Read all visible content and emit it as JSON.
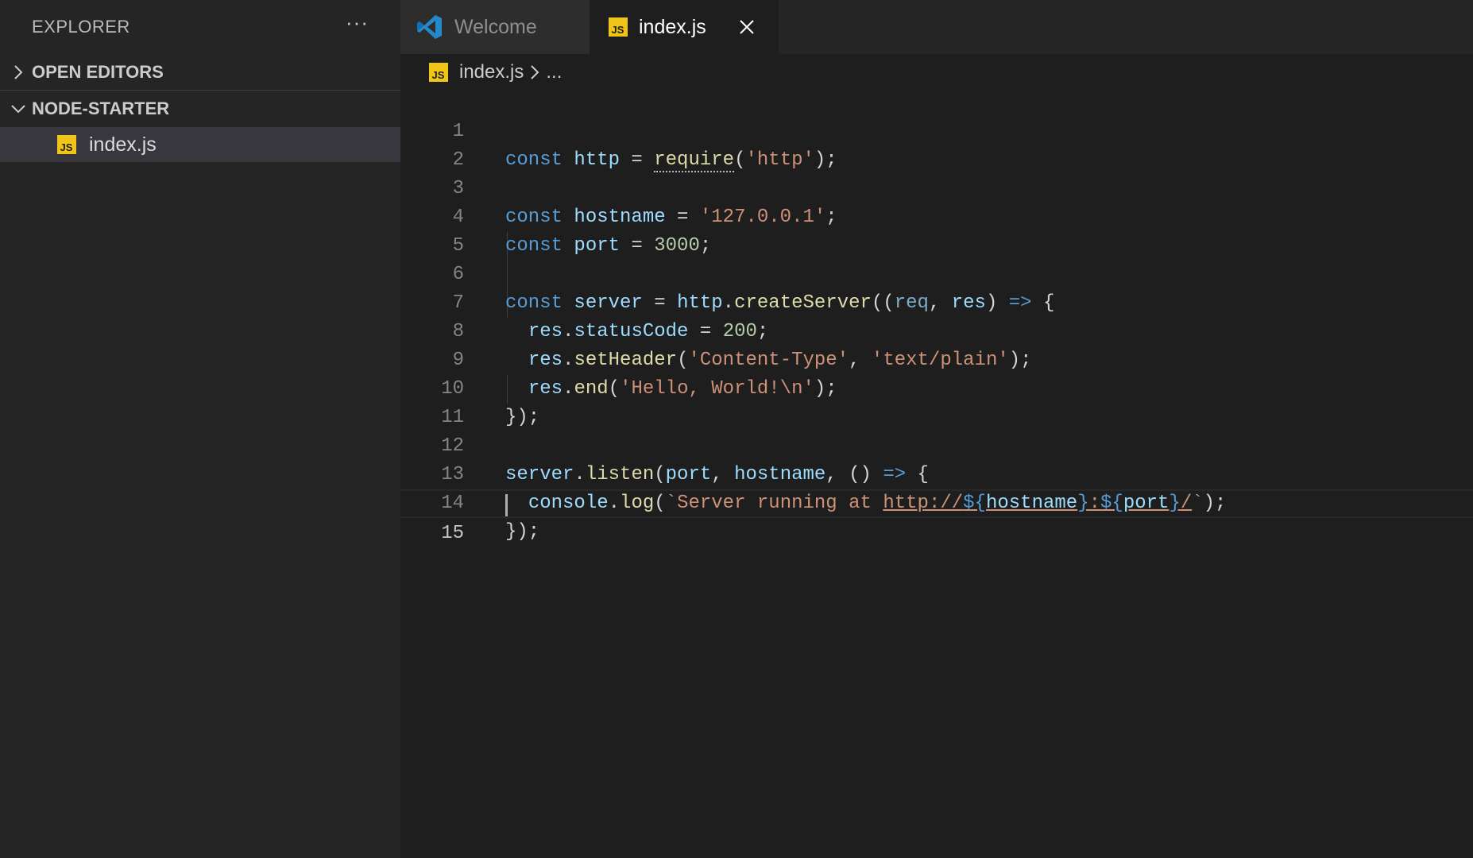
{
  "sidebar": {
    "title": "EXPLORER",
    "more_actions": "···",
    "sections": [
      {
        "label": "OPEN EDITORS",
        "expanded": false
      },
      {
        "label": "NODE-STARTER",
        "expanded": true
      }
    ],
    "files": [
      {
        "name": "index.js",
        "badge": "JS"
      }
    ]
  },
  "tabs": [
    {
      "label": "Welcome",
      "icon": "vscode-logo-icon",
      "active": false
    },
    {
      "label": "index.js",
      "icon": "js-file-icon",
      "badge": "JS",
      "active": true
    }
  ],
  "breadcrumb": {
    "file": "index.js",
    "badge": "JS",
    "rest": "..."
  },
  "editor": {
    "line_numbers": [
      "1",
      "2",
      "3",
      "4",
      "5",
      "6",
      "7",
      "8",
      "9",
      "10",
      "11",
      "12",
      "13",
      "14",
      "15"
    ],
    "cursor_line": 15
  },
  "colors": {
    "keyword": "#569cd6",
    "variable": "#9cdcfe",
    "function": "#dcdcaa",
    "string": "#ce9178",
    "number": "#b5cea8",
    "js_badge": "#f0c419"
  }
}
